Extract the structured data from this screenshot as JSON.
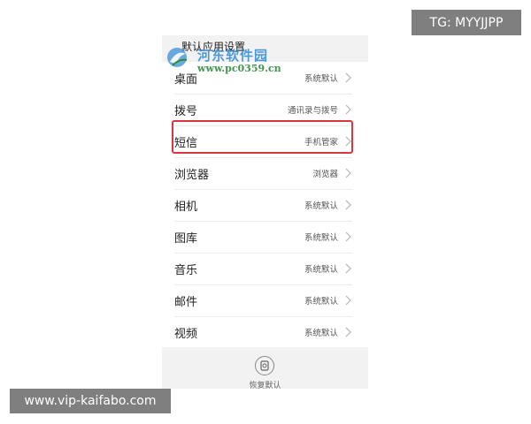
{
  "header": {
    "title": "默认应用设置"
  },
  "watermark": {
    "site_name": "河东软件园",
    "url": "www.pc0359.cn"
  },
  "settings": {
    "items": [
      {
        "label": "桌面",
        "value": "系统默认"
      },
      {
        "label": "拨号",
        "value": "通讯录与拨号"
      },
      {
        "label": "短信",
        "value": "手机管家",
        "highlighted": true
      },
      {
        "label": "浏览器",
        "value": "浏览器"
      },
      {
        "label": "相机",
        "value": "系统默认"
      },
      {
        "label": "图库",
        "value": "系统默认"
      },
      {
        "label": "音乐",
        "value": "系统默认"
      },
      {
        "label": "邮件",
        "value": "系统默认"
      },
      {
        "label": "视频",
        "value": "系统默认"
      }
    ]
  },
  "footer": {
    "restore_label": "恢复默认",
    "restore_icon": "restore-icon"
  },
  "overlays": {
    "tg_label": "TG: MYYJJPP",
    "site_label": "www.vip-kaifabo.com"
  },
  "colors": {
    "highlight_border": "#d9363e",
    "watermark_blue": "#3b8fd6",
    "watermark_green": "#2e8b3a",
    "badge_bg": "#7f7f7f"
  }
}
